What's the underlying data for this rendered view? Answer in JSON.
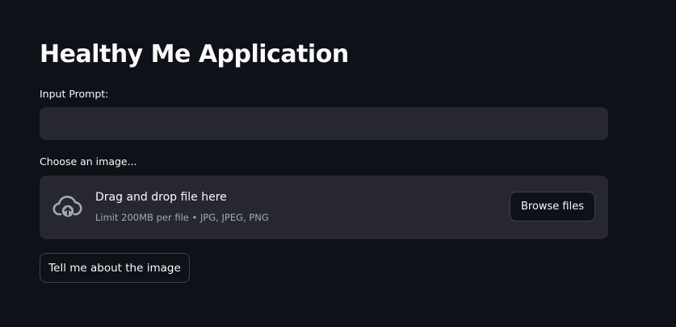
{
  "app": {
    "title": "Healthy Me Application"
  },
  "prompt": {
    "label": "Input Prompt:",
    "value": "",
    "placeholder": ""
  },
  "uploader": {
    "label": "Choose an image...",
    "icon": "cloud-upload-icon",
    "drop_text": "Drag and drop file here",
    "limit_text": "Limit 200MB per file • JPG, JPEG, PNG",
    "browse_label": "Browse files"
  },
  "submit": {
    "label": "Tell me about the image"
  },
  "colors": {
    "background": "#0e1117",
    "surface": "#262730",
    "text": "#fafafa",
    "muted_text": "#a3a8b4",
    "border": "#3f414c"
  }
}
